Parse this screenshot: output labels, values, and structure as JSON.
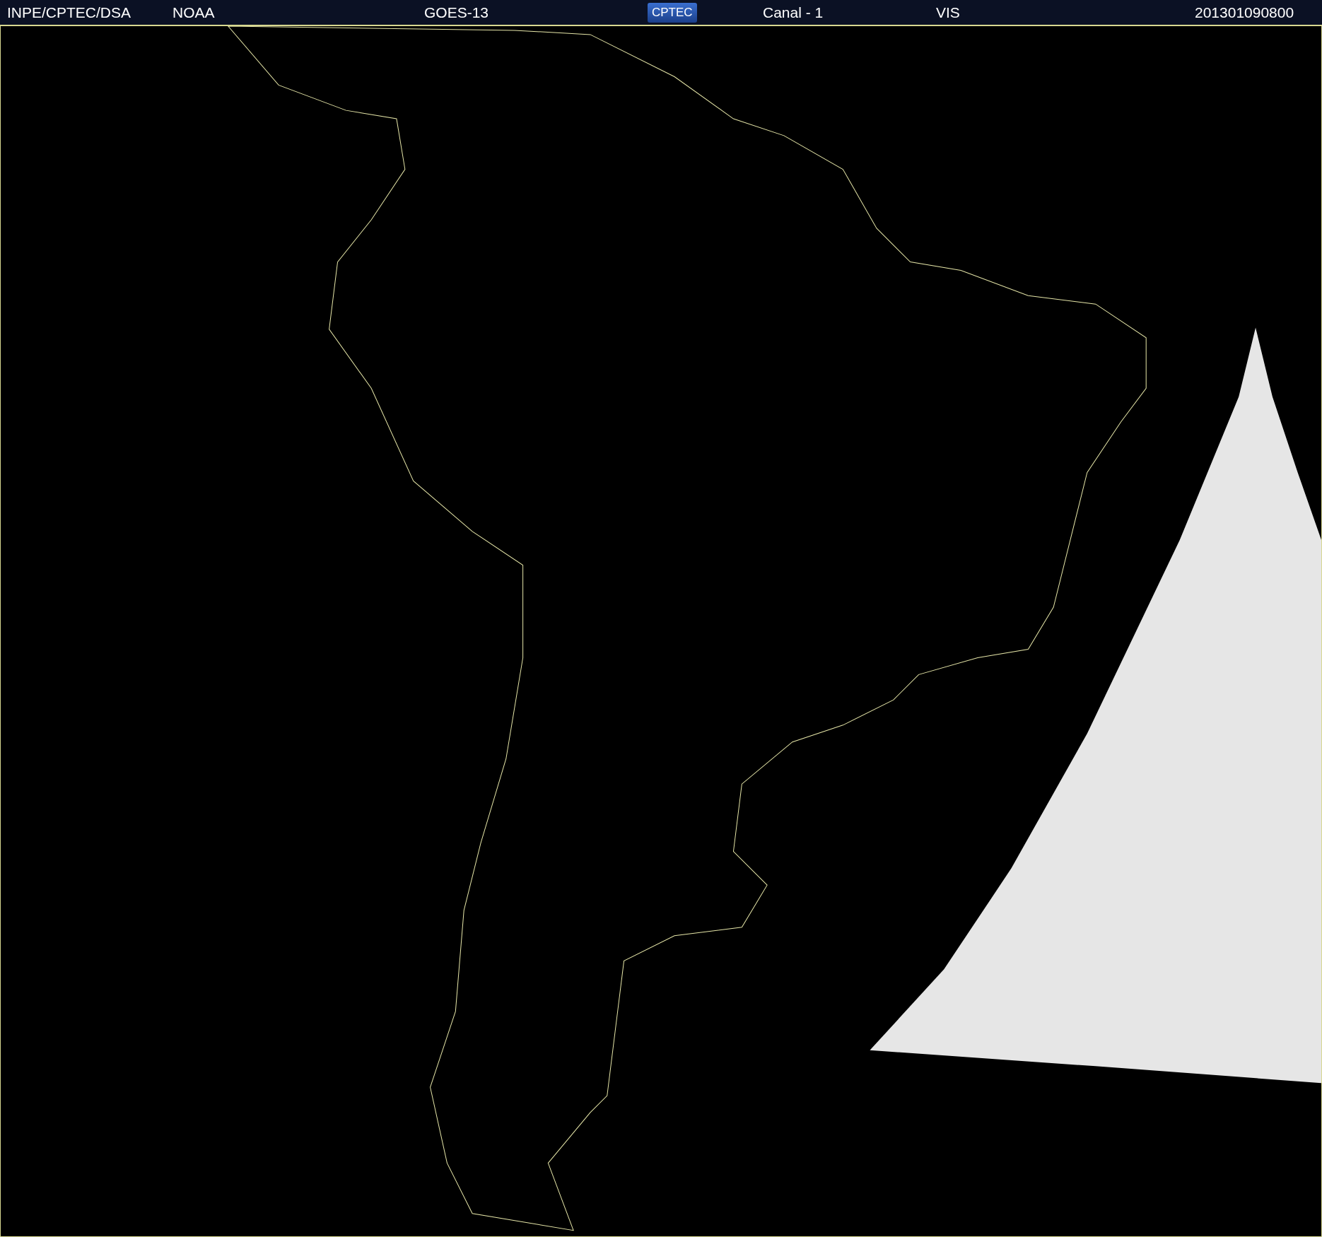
{
  "header": {
    "items": [
      {
        "kind": "text",
        "text": "INPE/CPTEC/DSA"
      },
      {
        "kind": "text",
        "text": "NOAA"
      },
      {
        "kind": "text",
        "text": "GOES-13"
      },
      {
        "kind": "logo",
        "text": "CPTEC"
      },
      {
        "kind": "text",
        "text": "Canal - 1"
      },
      {
        "kind": "text",
        "text": "VIS"
      },
      {
        "kind": "text",
        "text": "201301090800"
      }
    ]
  }
}
